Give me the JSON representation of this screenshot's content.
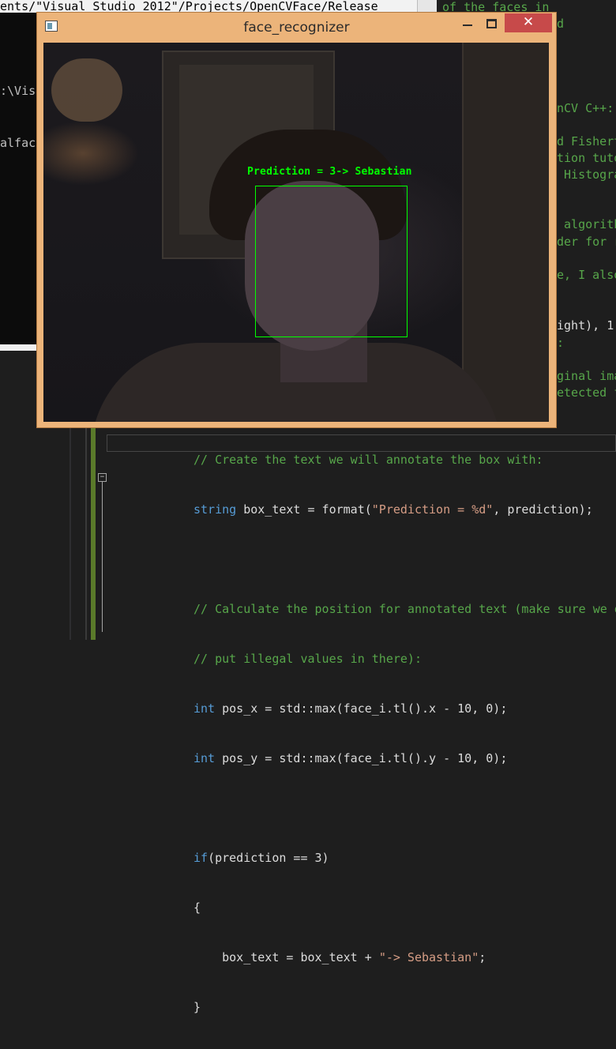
{
  "console": {
    "title": "ents/\"Visual Studio 2012\"/Projects/OpenCVFace/Release",
    "lines": [
      ":\\Visu",
      "alfac"
    ]
  },
  "editor": {
    "right_fragments": [
      "of the faces in",
      "d",
      "nCV C++:",
      "d Fishert",
      "tion tuto",
      " Histogra",
      " algorith",
      "der for r",
      "e, I also",
      "ight), 1",
      ":",
      "ginal ima",
      "etected f"
    ],
    "code_lines": {
      "l0": "// Create the text we will annotate the box with:",
      "l1_type": "string",
      "l1_rest": " box_text = format(",
      "l1_str": "\"Prediction = %d\"",
      "l1_end": ", prediction);",
      "l3": "// Calculate the position for annotated text (make sure we d",
      "l4": "// put illegal values in there):",
      "l5_type": "int",
      "l5_rest": " pos_x = std::max(face_i.tl().x - 10, 0);",
      "l6_type": "int",
      "l6_rest": " pos_y = std::max(face_i.tl().y - 10, 0);",
      "l8_kw": "if",
      "l8_rest": "(prediction == 3)",
      "l9": "{",
      "l10_a": "    box_text = box_text + ",
      "l10_str": "\"-> Sebastian\"",
      "l10_end": ";",
      "l11": "}"
    }
  },
  "window": {
    "title": "face_recognizer",
    "close_glyph": "✕",
    "prediction_label": "Prediction = 3-> Sebastian"
  }
}
